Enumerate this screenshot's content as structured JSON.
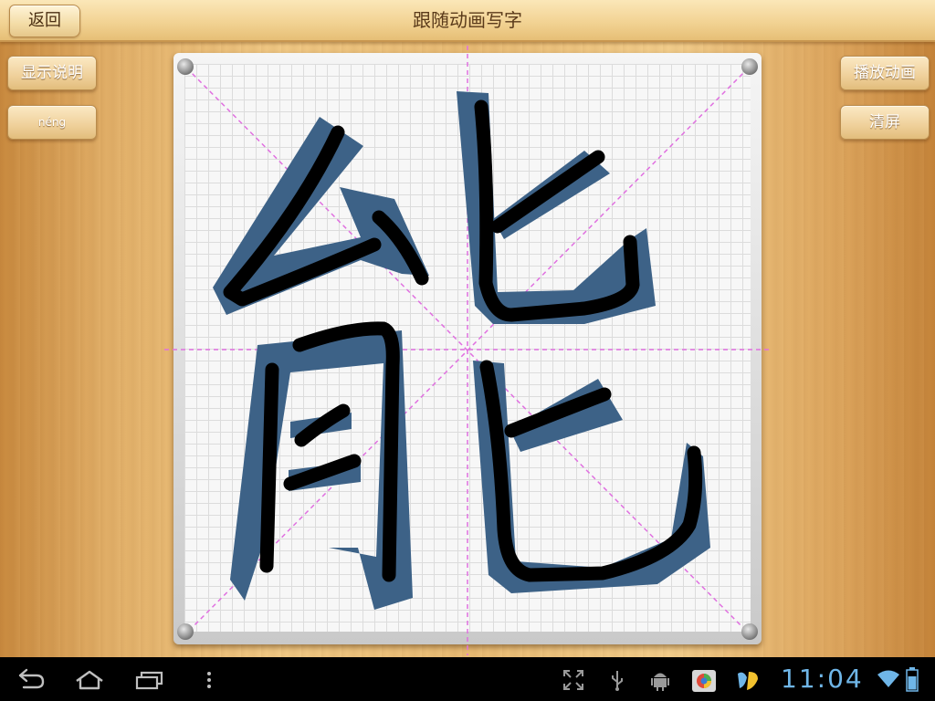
{
  "app": {
    "title": "跟随动画写字",
    "back_label": "返回"
  },
  "left_buttons": {
    "show_instructions": "显示说明",
    "pinyin": "néng"
  },
  "right_buttons": {
    "play_animation": "播放动画",
    "clear_screen": "清屏"
  },
  "board": {
    "character": "能"
  },
  "status_bar": {
    "time": "11:04",
    "icons": [
      "fullscreen-icon",
      "usb-icon",
      "android-debug-icon",
      "app-store-icon",
      "app-notification-icon",
      "wifi-icon",
      "battery-icon"
    ]
  },
  "nav_bar": {
    "icons": [
      "back-icon",
      "home-icon",
      "recent-apps-icon",
      "menu-icon"
    ]
  },
  "colors": {
    "guide_line": "#e070e0",
    "template_stroke": "#3d6287",
    "user_stroke": "#000000",
    "clock": "#6fb6e8"
  }
}
